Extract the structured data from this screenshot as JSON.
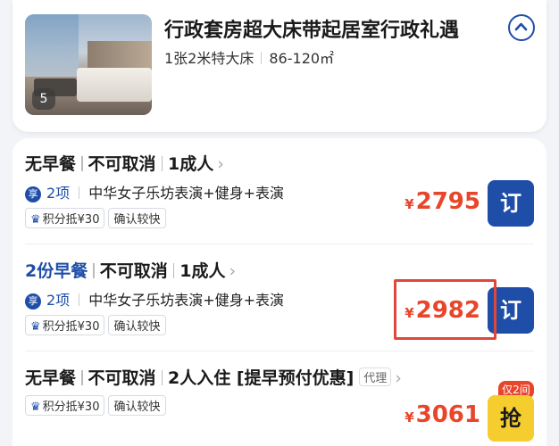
{
  "room": {
    "title": "行政套房超大床带起居室行政礼遇",
    "bed": "1张2米特大床",
    "area": "86-120㎡",
    "photo_count": "5"
  },
  "rates": [
    {
      "breakfast": "无早餐",
      "cancel": "不可取消",
      "guests": "1成人",
      "perk_icon": "享",
      "perk_count": "2项",
      "perk_desc": "中华女子乐坊表演+健身+表演",
      "points": "积分抵¥30",
      "confirm": "确认较快",
      "currency": "¥",
      "price": "2795",
      "action": "订"
    },
    {
      "breakfast": "2份早餐",
      "cancel": "不可取消",
      "guests": "1成人",
      "perk_icon": "享",
      "perk_count": "2项",
      "perk_desc": "中华女子乐坊表演+健身+表演",
      "points": "积分抵¥30",
      "confirm": "确认较快",
      "currency": "¥",
      "price": "2982",
      "action": "订"
    },
    {
      "breakfast": "无早餐",
      "cancel": "不可取消",
      "guests": "2人入住",
      "promo": "[提早预付优惠]",
      "agent": "代理",
      "points": "积分抵¥30",
      "confirm": "确认较快",
      "currency": "¥",
      "price": "3061",
      "action": "抢",
      "limit": "仅2间"
    }
  ],
  "colors": {
    "brand_blue": "#1e4ea8",
    "price_red": "#e8462b",
    "grab_yellow": "#f5cd2e",
    "highlight": "#e0463a"
  }
}
